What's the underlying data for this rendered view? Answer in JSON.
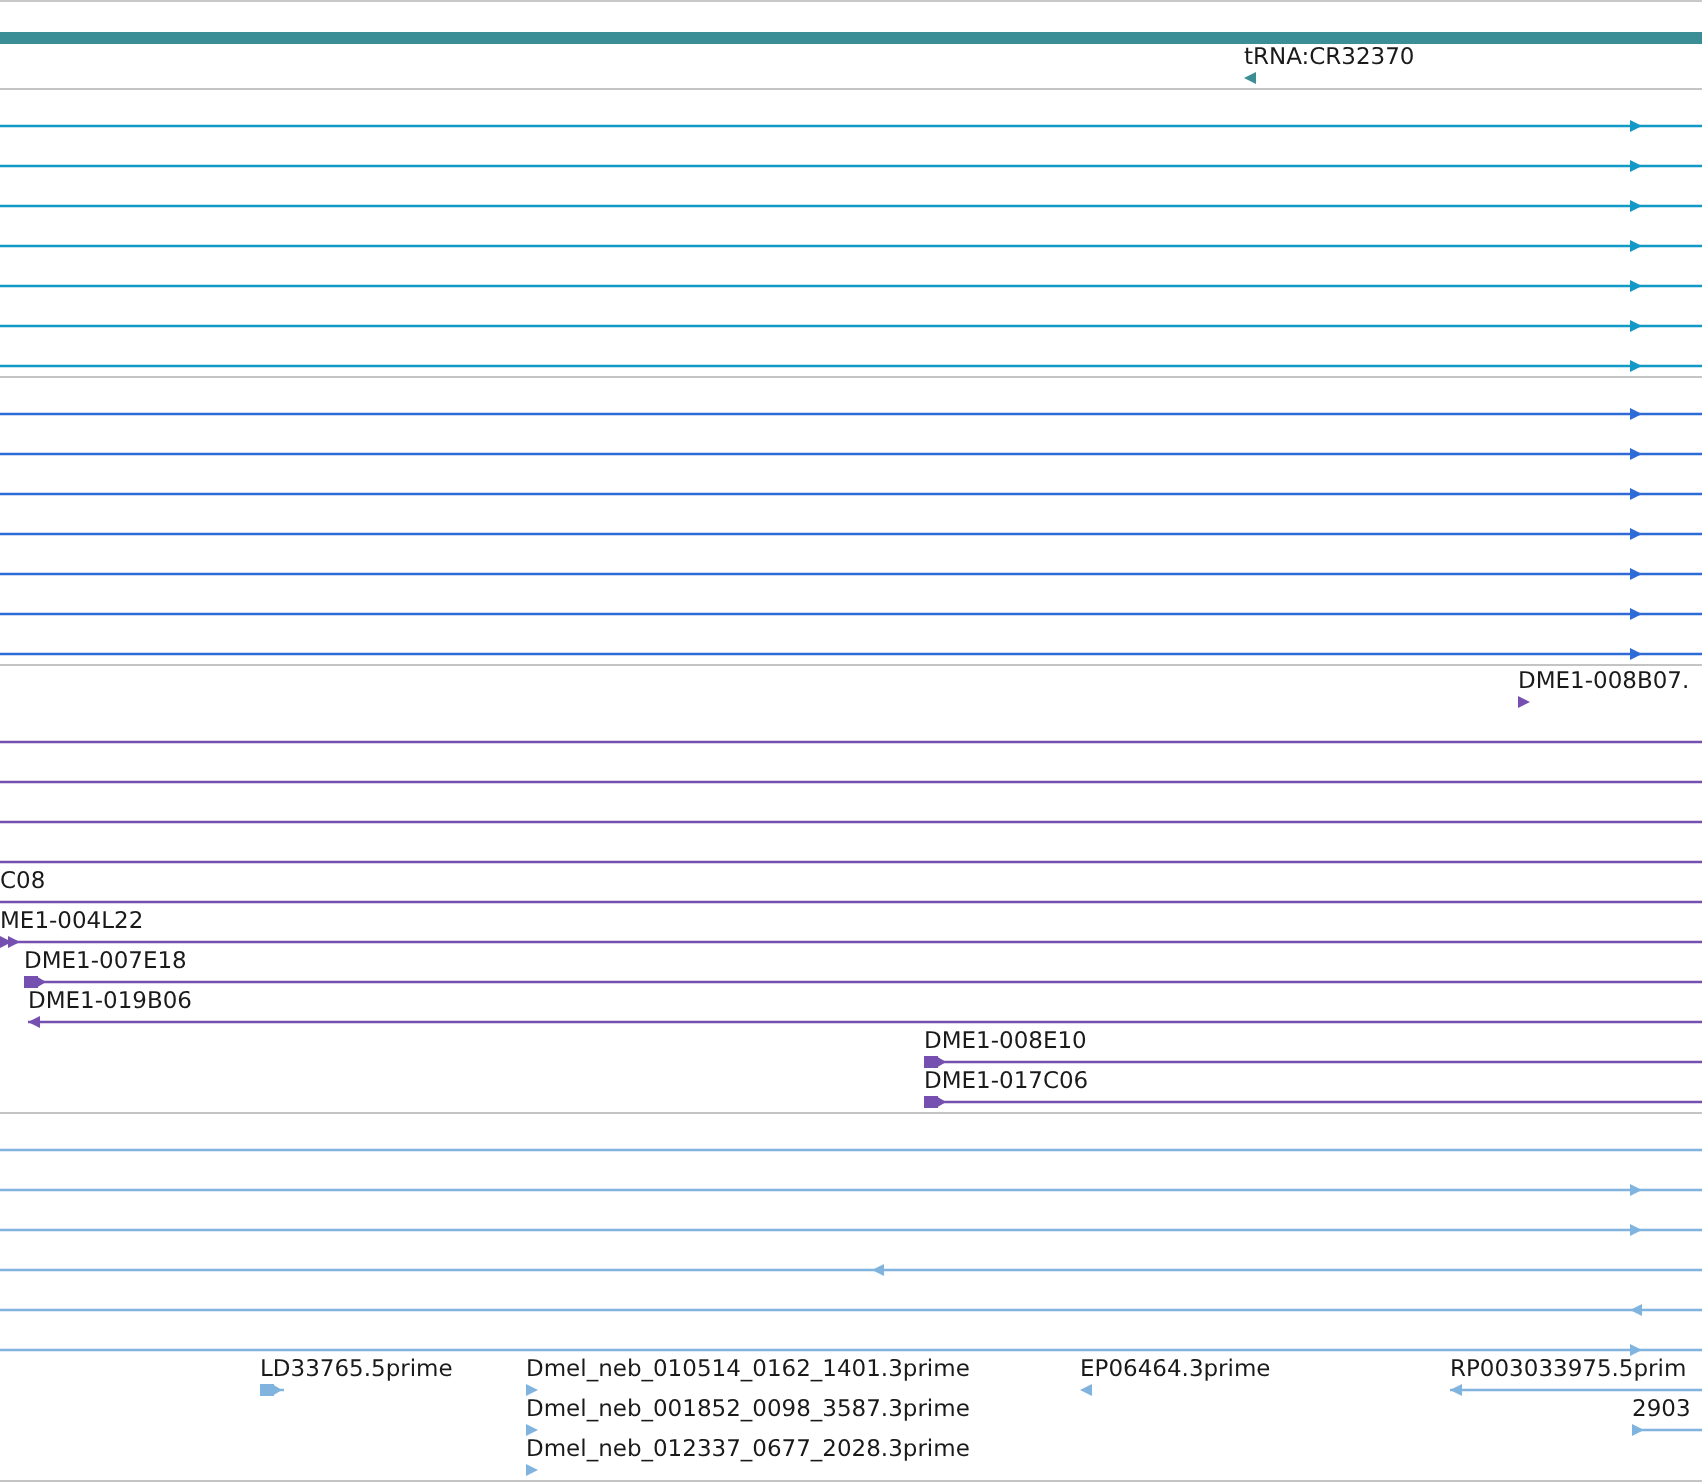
{
  "tracks": [
    {
      "color": "#3b8e96",
      "rows": [
        {
          "features": [
            {
              "kind": "bar"
            }
          ]
        },
        {
          "features": [
            {
              "kind": "tip",
              "label": "tRNA:CR32370",
              "reverse": true
            }
          ]
        }
      ]
    },
    {
      "color": "#1399c6",
      "rows": [
        {
          "features": [
            {
              "kind": "line",
              "reverse": false
            }
          ]
        },
        {
          "features": [
            {
              "kind": "line",
              "reverse": false
            }
          ]
        },
        {
          "features": [
            {
              "kind": "line",
              "reverse": false
            }
          ]
        },
        {
          "features": [
            {
              "kind": "line",
              "reverse": false
            }
          ]
        },
        {
          "features": [
            {
              "kind": "line",
              "reverse": false
            }
          ]
        },
        {
          "features": [
            {
              "kind": "line",
              "reverse": false
            }
          ]
        },
        {
          "features": [
            {
              "kind": "line",
              "reverse": false
            }
          ]
        }
      ]
    },
    {
      "color": "#2e6bd6",
      "rows": [
        {
          "features": [
            {
              "kind": "line",
              "reverse": false
            }
          ]
        },
        {
          "features": [
            {
              "kind": "line",
              "reverse": false
            }
          ]
        },
        {
          "features": [
            {
              "kind": "line",
              "reverse": false
            }
          ]
        },
        {
          "features": [
            {
              "kind": "line",
              "reverse": false
            }
          ]
        },
        {
          "features": [
            {
              "kind": "line",
              "reverse": false
            }
          ]
        },
        {
          "features": [
            {
              "kind": "line",
              "reverse": false
            }
          ]
        },
        {
          "features": [
            {
              "kind": "line",
              "reverse": false
            }
          ]
        }
      ]
    },
    {
      "color": "#7650b0",
      "rows": [
        {
          "features": [
            {
              "kind": "tip",
              "label": "DME1-008B07.",
              "reverse": false
            }
          ]
        },
        {
          "features": [
            {
              "kind": "line"
            }
          ]
        },
        {
          "features": [
            {
              "kind": "line"
            }
          ]
        },
        {
          "features": [
            {
              "kind": "line"
            }
          ]
        },
        {
          "features": [
            {
              "kind": "line"
            }
          ]
        },
        {
          "features": [
            {
              "kind": "line",
              "label": "C08"
            }
          ]
        },
        {
          "features": [
            {
              "kind": "double",
              "label": "ME1-004L22",
              "reverse": false
            }
          ]
        },
        {
          "features": [
            {
              "kind": "block",
              "label": "DME1-007E18",
              "reverse": false
            }
          ]
        },
        {
          "features": [
            {
              "kind": "line",
              "label": "DME1-019B06",
              "reverse": true
            }
          ]
        },
        {
          "features": [
            {
              "kind": "block",
              "label": "DME1-008E10",
              "reverse": false
            }
          ]
        },
        {
          "features": [
            {
              "kind": "block",
              "label": "DME1-017C06",
              "reverse": false
            }
          ]
        }
      ]
    },
    {
      "color": "#80b3de",
      "rows": [
        {
          "features": [
            {
              "kind": "line"
            }
          ]
        },
        {
          "features": [
            {
              "kind": "line",
              "reverse": false
            }
          ]
        },
        {
          "features": [
            {
              "kind": "line",
              "reverse": false
            }
          ]
        },
        {
          "features": [
            {
              "kind": "line",
              "reverse": true
            }
          ]
        },
        {
          "features": [
            {
              "kind": "line",
              "reverse": true
            }
          ]
        },
        {
          "features": [
            {
              "kind": "line",
              "reverse": false
            }
          ]
        },
        {
          "features": [
            {
              "kind": "block",
              "label": "LD33765.5prime",
              "reverse": false
            },
            {
              "kind": "tip",
              "label": "Dmel_neb_010514_0162_1401.3prime",
              "reverse": false
            },
            {
              "kind": "tip",
              "label": "EP06464.3prime",
              "reverse": true
            },
            {
              "kind": "line",
              "label": "RP003033975.5prim",
              "reverse": true
            }
          ]
        },
        {
          "features": [
            {
              "kind": "tip",
              "label": "Dmel_neb_001852_0098_3587.3prime",
              "reverse": false
            },
            {
              "kind": "line",
              "label": "2903",
              "reverse": false
            }
          ]
        },
        {
          "features": [
            {
              "kind": "tip",
              "label": "Dmel_neb_012337_0677_2028.3prime",
              "reverse": false
            }
          ]
        }
      ]
    }
  ]
}
